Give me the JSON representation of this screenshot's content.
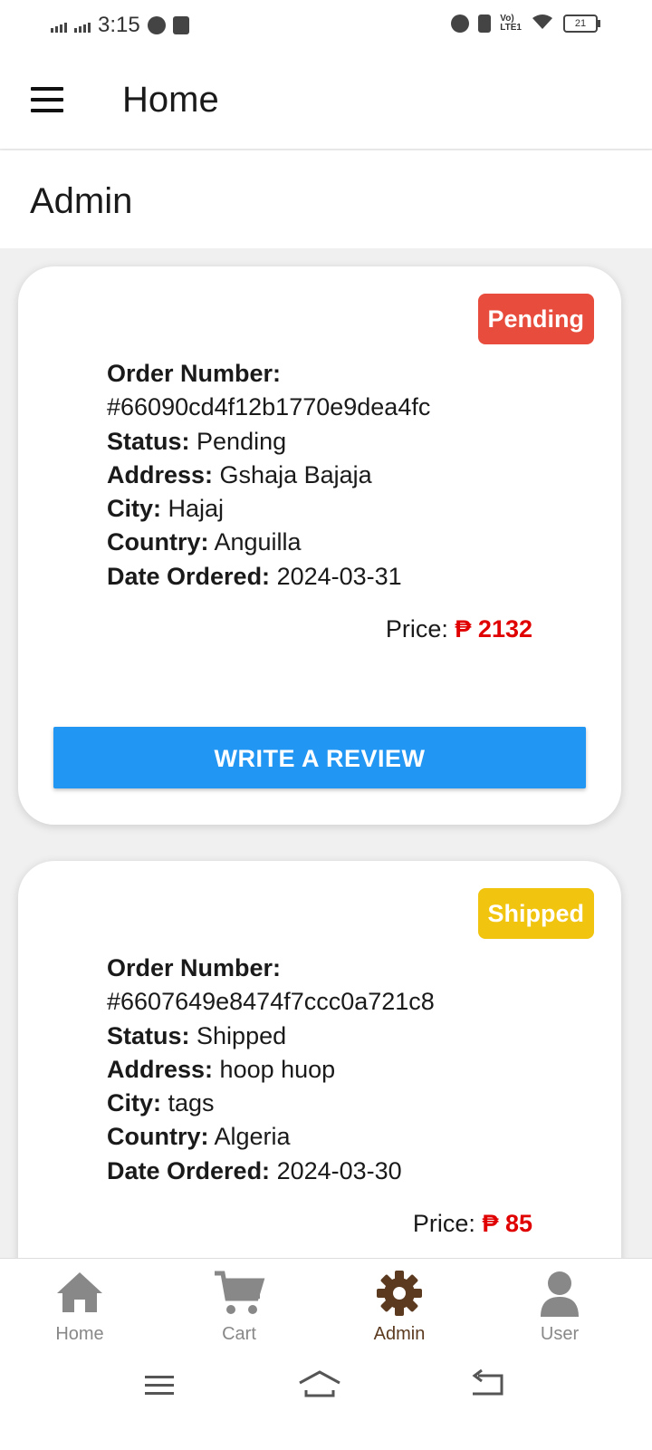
{
  "status_bar": {
    "time": "3:15",
    "battery": "21"
  },
  "app_bar": {
    "title": "Home"
  },
  "section": {
    "title": "Admin"
  },
  "orders": [
    {
      "status_badge": "Pending",
      "order_number_label": "Order Number:",
      "order_number": "#66090cd4f12b1770e9dea4fc",
      "status_label": "Status:",
      "status": "Pending",
      "address_label": "Address:",
      "address": "Gshaja Bajaja",
      "city_label": "City:",
      "city": "Hajaj",
      "country_label": "Country:",
      "country": "Anguilla",
      "date_label": "Date Ordered:",
      "date": "2024-03-31",
      "price_label": "Price:",
      "price": "₱ 2132",
      "review_button": "WRITE A REVIEW"
    },
    {
      "status_badge": "Shipped",
      "order_number_label": "Order Number:",
      "order_number": "#6607649e8474f7ccc0a721c8",
      "status_label": "Status:",
      "status": "Shipped",
      "address_label": "Address:",
      "address": "hoop huop",
      "city_label": "City:",
      "city": "tags",
      "country_label": "Country:",
      "country": "Algeria",
      "date_label": "Date Ordered:",
      "date": "2024-03-30",
      "price_label": "Price:",
      "price": "₱ 85"
    }
  ],
  "bottom_nav": [
    {
      "label": "Home",
      "icon": "home-icon"
    },
    {
      "label": "Cart",
      "icon": "cart-icon"
    },
    {
      "label": "Admin",
      "icon": "gear-icon",
      "active": true
    },
    {
      "label": "User",
      "icon": "user-icon"
    }
  ],
  "colors": {
    "pending": "#e74c3c",
    "shipped": "#f1c40f",
    "accent": "#2196f3",
    "price": "#e00000",
    "active_nav": "#5b3a1f"
  }
}
